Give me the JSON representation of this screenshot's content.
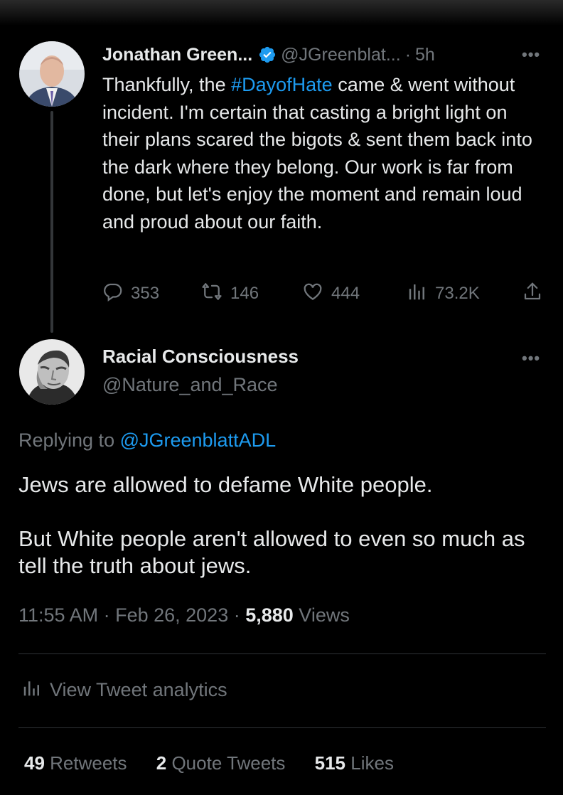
{
  "parent_tweet": {
    "author_name": "Jonathan Green...",
    "handle": "@JGreenblat...",
    "separator": "·",
    "time": "5h",
    "more": "•••",
    "text_before": "Thankfully, the ",
    "hashtag": "#DayofHate",
    "text_after": " came & went without incident. I'm certain that casting a bright light on their plans scared the bigots & sent them back into the dark where they belong. Our work is far from done, but let's enjoy the moment and remain loud and proud about our faith.",
    "replies": "353",
    "retweets": "146",
    "likes": "444",
    "views": "73.2K"
  },
  "reply_tweet": {
    "author_name": "Racial Consciousness",
    "handle": "@Nature_and_Race",
    "more": "•••",
    "replying_prefix": "Replying to ",
    "replying_to": "@JGreenblattADL",
    "paragraph_1": "Jews are allowed to defame White people.",
    "paragraph_2": "But White people aren't allowed to even so much as tell the truth about jews.",
    "time": "11:55 AM",
    "sep1": " · ",
    "date": "Feb 26, 2023",
    "sep2": " · ",
    "views_count": "5,880",
    "views_label": " Views",
    "analytics_label": "View Tweet analytics",
    "retweets_count": "49",
    "retweets_label": " Retweets",
    "quotes_count": "2",
    "quotes_label": " Quote Tweets",
    "likes_count": "515",
    "likes_label": " Likes"
  },
  "colors": {
    "background": "#000000",
    "text": "#e7e9ea",
    "muted": "#71767b",
    "accent": "#1d9bf0",
    "divider": "#2f3336"
  },
  "icons": [
    "verified-badge-icon",
    "reply-icon",
    "retweet-icon",
    "like-icon",
    "views-icon",
    "share-icon",
    "analytics-icon",
    "more-icon"
  ]
}
